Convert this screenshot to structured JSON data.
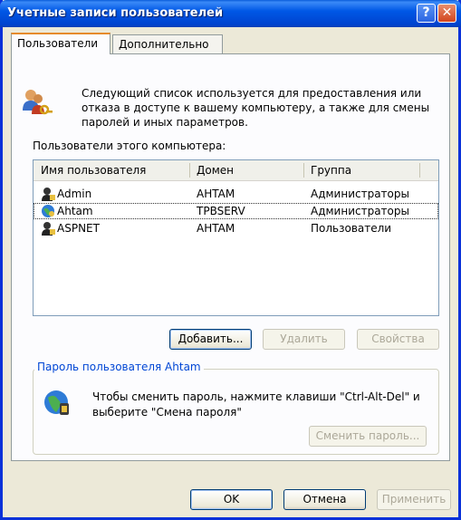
{
  "window": {
    "title": "Учетные записи пользователей",
    "help_glyph": "?",
    "close_glyph": "✕"
  },
  "tabs": [
    {
      "label": "Пользователи"
    },
    {
      "label": "Дополнительно"
    }
  ],
  "intro_text": "Следующий список используется для предоставления или отказа в доступе к вашему компьютеру, а также для смены паролей и иных параметров.",
  "users_list": {
    "label": "Пользователи этого компьютера:",
    "columns": [
      "Имя пользователя",
      "Домен",
      "Группа"
    ],
    "rows": [
      {
        "name": "Admin",
        "domain": "AHTAM",
        "group": "Администраторы"
      },
      {
        "name": "Ahtam",
        "domain": "TPBSERV",
        "group": "Администраторы"
      },
      {
        "name": "ASPNET",
        "domain": "AHTAM",
        "group": "Пользователи"
      }
    ]
  },
  "list_buttons": {
    "add": "Добавить...",
    "remove": "Удалить",
    "properties": "Свойства"
  },
  "password_group": {
    "title": "Пароль пользователя Ahtam",
    "text": "Чтобы сменить пароль, нажмите клавиши \"Ctrl-Alt-Del\" и выберите \"Смена пароля\"",
    "button": "Сменить пароль..."
  },
  "dialog_buttons": {
    "ok": "OK",
    "cancel": "Отмена",
    "apply": "Применить"
  }
}
